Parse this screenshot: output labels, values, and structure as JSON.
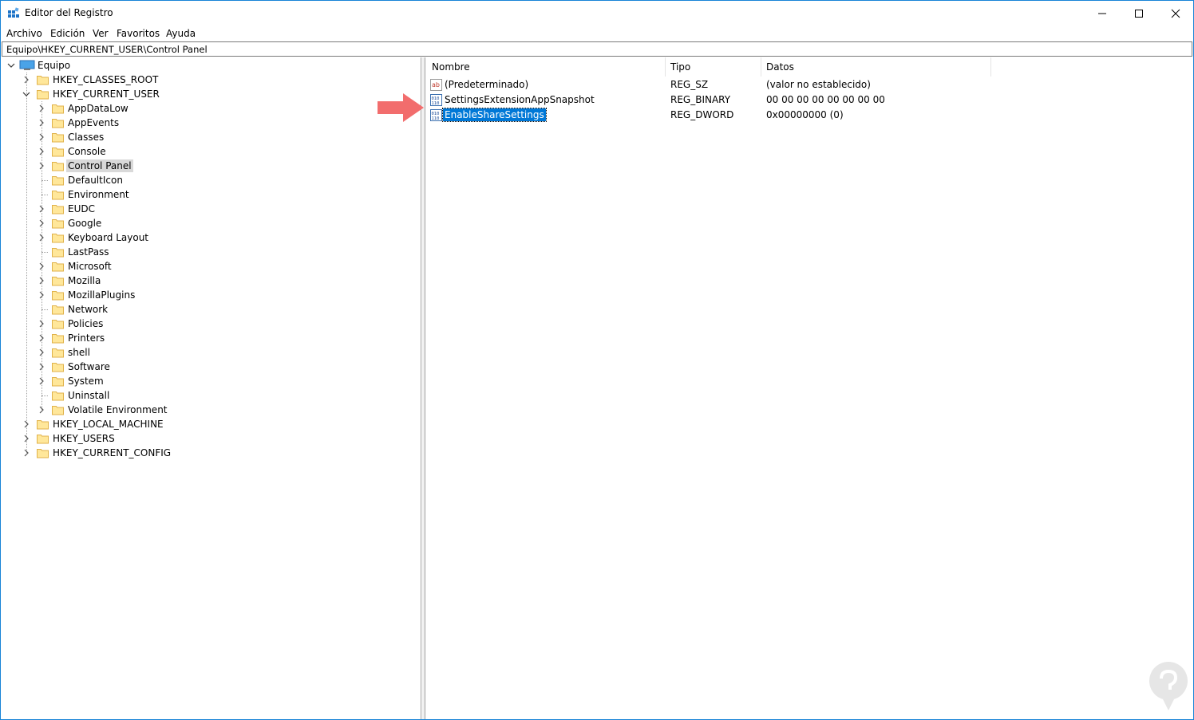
{
  "window": {
    "title": "Editor del Registro",
    "accent_color": "#1883d7"
  },
  "menu": [
    "Archivo",
    "Edición",
    "Ver",
    "Favoritos",
    "Ayuda"
  ],
  "address": "Equipo\\HKEY_CURRENT_USER\\Control Panel",
  "tree": {
    "root": "Equipo",
    "hives": [
      {
        "label": "HKEY_CLASSES_ROOT",
        "expanded": false
      },
      {
        "label": "HKEY_CURRENT_USER",
        "expanded": true
      },
      {
        "label": "HKEY_LOCAL_MACHINE",
        "expanded": false
      },
      {
        "label": "HKEY_USERS",
        "expanded": false
      },
      {
        "label": "HKEY_CURRENT_CONFIG",
        "expanded": false
      }
    ],
    "current_user_children": [
      {
        "label": "AppDataLow",
        "has_children": true
      },
      {
        "label": "AppEvents",
        "has_children": true
      },
      {
        "label": "Classes",
        "has_children": true
      },
      {
        "label": "Console",
        "has_children": true
      },
      {
        "label": "Control Panel",
        "has_children": true,
        "selected": true
      },
      {
        "label": "DefaultIcon",
        "has_children": false
      },
      {
        "label": "Environment",
        "has_children": false
      },
      {
        "label": "EUDC",
        "has_children": true
      },
      {
        "label": "Google",
        "has_children": true
      },
      {
        "label": "Keyboard Layout",
        "has_children": true
      },
      {
        "label": "LastPass",
        "has_children": false
      },
      {
        "label": "Microsoft",
        "has_children": true
      },
      {
        "label": "Mozilla",
        "has_children": true
      },
      {
        "label": "MozillaPlugins",
        "has_children": true
      },
      {
        "label": "Network",
        "has_children": false
      },
      {
        "label": "Policies",
        "has_children": true
      },
      {
        "label": "Printers",
        "has_children": true
      },
      {
        "label": "shell",
        "has_children": true
      },
      {
        "label": "Software",
        "has_children": true
      },
      {
        "label": "System",
        "has_children": true
      },
      {
        "label": "Uninstall",
        "has_children": false
      },
      {
        "label": "Volatile Environment",
        "has_children": true
      }
    ]
  },
  "list": {
    "columns": [
      "Nombre",
      "Tipo",
      "Datos"
    ],
    "rows": [
      {
        "icon": "string-value-icon",
        "name": "(Predeterminado)",
        "type": "REG_SZ",
        "data": "(valor no establecido)",
        "selected": false
      },
      {
        "icon": "binary-value-icon",
        "name": "SettingsExtensionAppSnapshot",
        "type": "REG_BINARY",
        "data": "00 00 00 00 00 00 00 00",
        "selected": false
      },
      {
        "icon": "binary-value-icon",
        "name": "EnableShareSettings",
        "type": "REG_DWORD",
        "data": "0x00000000 (0)",
        "selected": true
      }
    ]
  },
  "annotation": {
    "icon": "right-arrow-icon",
    "color": "#f26d6d"
  },
  "watermark": {
    "icon": "solvetic-logo-icon",
    "color": "#e0e0e0"
  }
}
